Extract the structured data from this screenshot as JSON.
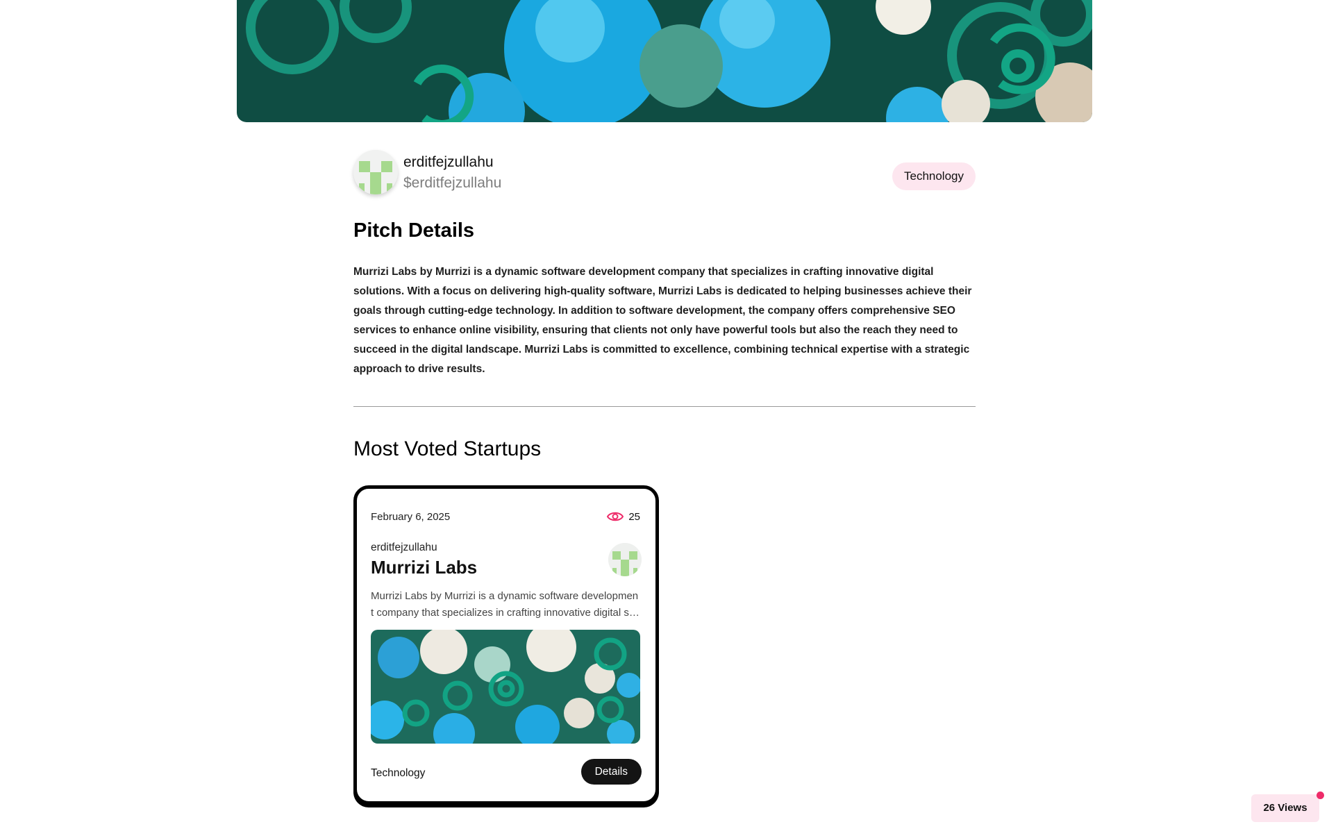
{
  "pitch": {
    "author_name": "erditfejzullahu",
    "author_handle": "$erditfejzullahu",
    "category": "Technology",
    "section_title": "Pitch Details",
    "description": "Murrizi Labs by Murrizi is a dynamic software development company that specializes in crafting innovative digital solutions. With a focus on delivering high-quality software, Murrizi Labs is dedicated to helping businesses achieve their goals through cutting-edge technology. In addition to software development, the company offers comprehensive SEO services to enhance online visibility, ensuring that clients not only have powerful tools but also the reach they need to succeed in the digital landscape. Murrizi Labs is committed to excellence, combining technical expertise with a strategic approach to drive results."
  },
  "most_voted": {
    "title": "Most Voted Startups",
    "cards": [
      {
        "date": "February 6, 2025",
        "views": "25",
        "author": "erditfejzullahu",
        "title": "Murrizi Labs",
        "description": "Murrizi Labs by Murrizi is a dynamic software development company that specializes in crafting innovative digital solutions.",
        "category": "Technology",
        "details_label": "Details"
      }
    ]
  },
  "views_badge": "26 Views",
  "colors": {
    "accent_pink": "#ee2b69",
    "pill_pink": "#fde6ef",
    "button_dark": "#141414"
  },
  "icons": {
    "views": "eye-icon",
    "avatar": "identicon-avatar"
  }
}
